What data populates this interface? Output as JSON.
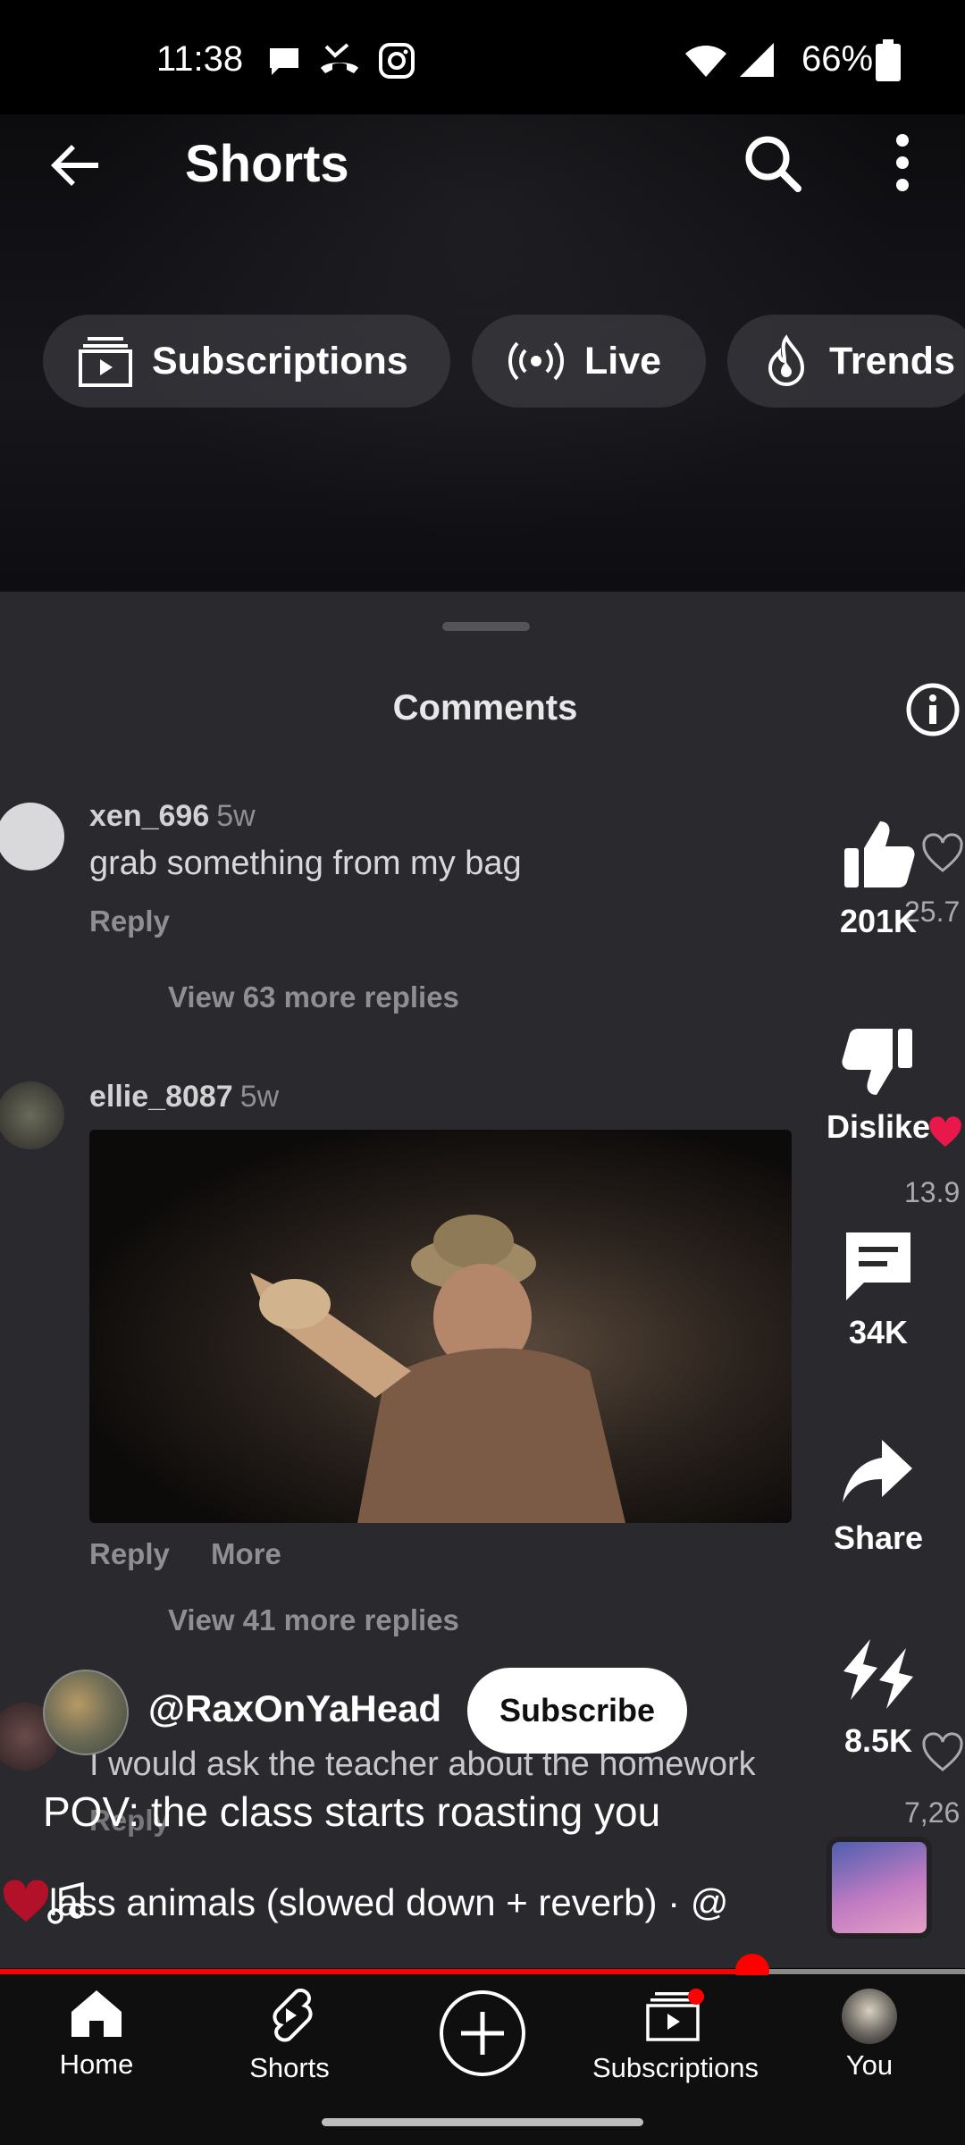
{
  "status_bar": {
    "time": "11:38",
    "battery": "66%",
    "icons": [
      "chat-bubble-icon",
      "missed-call-icon",
      "instagram-icon",
      "wifi-icon",
      "signal-icon",
      "battery-icon"
    ]
  },
  "header": {
    "title": "Shorts",
    "icons": [
      "back-arrow-icon",
      "search-icon",
      "more-vertical-icon"
    ]
  },
  "chips": [
    {
      "label": "Subscriptions",
      "icon": "subscriptions-icon"
    },
    {
      "label": "Live",
      "icon": "live-icon"
    },
    {
      "label": "Trends",
      "icon": "trends-icon"
    }
  ],
  "video_content": {
    "panel_title": "Comments",
    "comments": [
      {
        "user": "xen_696",
        "age": "5w",
        "text": "grab something from my bag",
        "reply": "Reply",
        "view_more": "View 63 more replies"
      },
      {
        "user": "ellie_8087",
        "age": "5w",
        "reply": "Reply",
        "more": "More",
        "view_more": "View 41 more replies"
      },
      {
        "text": "I would ask the teacher about the homework",
        "reply": "Reply"
      }
    ],
    "ghost_counts": [
      "25.7",
      "13.9",
      "7,26"
    ]
  },
  "actions": {
    "like_count": "201K",
    "dislike_label": "Dislike",
    "comment_count": "34K",
    "share_label": "Share",
    "remix_count": "8.5K"
  },
  "channel": {
    "handle": "@RaxOnYaHead",
    "subscribe_label": "Subscribe"
  },
  "video_title": "POV: the class starts roasting you",
  "sound": "lass animals (slowed down + reverb) · @",
  "progress": {
    "fraction": 0.78
  },
  "nav": [
    {
      "label": "Home",
      "icon": "home-icon"
    },
    {
      "label": "Shorts",
      "icon": "shorts-icon"
    },
    {
      "label": "",
      "icon": "create-plus-icon"
    },
    {
      "label": "Subscriptions",
      "icon": "subscriptions-icon"
    },
    {
      "label": "You",
      "icon": "profile-avatar"
    }
  ],
  "colors": {
    "accent": "#ff0000",
    "chip_bg": "#46464b",
    "nav_bg": "#0f0f0f"
  }
}
